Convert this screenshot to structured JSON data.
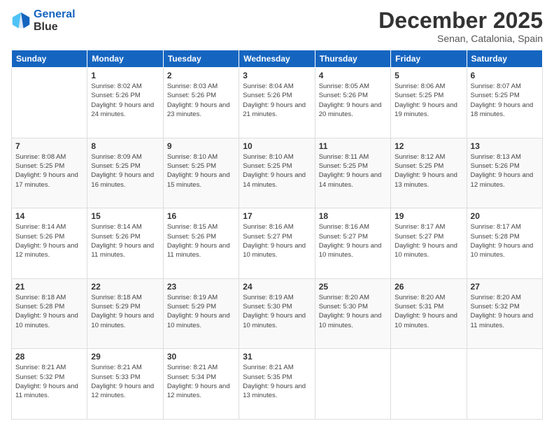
{
  "logo": {
    "line1": "General",
    "line2": "Blue"
  },
  "header": {
    "month": "December 2025",
    "location": "Senan, Catalonia, Spain"
  },
  "weekdays": [
    "Sunday",
    "Monday",
    "Tuesday",
    "Wednesday",
    "Thursday",
    "Friday",
    "Saturday"
  ],
  "weeks": [
    [
      {
        "day": "",
        "info": ""
      },
      {
        "day": "1",
        "info": "Sunrise: 8:02 AM\nSunset: 5:26 PM\nDaylight: 9 hours\nand 24 minutes."
      },
      {
        "day": "2",
        "info": "Sunrise: 8:03 AM\nSunset: 5:26 PM\nDaylight: 9 hours\nand 23 minutes."
      },
      {
        "day": "3",
        "info": "Sunrise: 8:04 AM\nSunset: 5:26 PM\nDaylight: 9 hours\nand 21 minutes."
      },
      {
        "day": "4",
        "info": "Sunrise: 8:05 AM\nSunset: 5:26 PM\nDaylight: 9 hours\nand 20 minutes."
      },
      {
        "day": "5",
        "info": "Sunrise: 8:06 AM\nSunset: 5:25 PM\nDaylight: 9 hours\nand 19 minutes."
      },
      {
        "day": "6",
        "info": "Sunrise: 8:07 AM\nSunset: 5:25 PM\nDaylight: 9 hours\nand 18 minutes."
      }
    ],
    [
      {
        "day": "7",
        "info": "Sunrise: 8:08 AM\nSunset: 5:25 PM\nDaylight: 9 hours\nand 17 minutes."
      },
      {
        "day": "8",
        "info": "Sunrise: 8:09 AM\nSunset: 5:25 PM\nDaylight: 9 hours\nand 16 minutes."
      },
      {
        "day": "9",
        "info": "Sunrise: 8:10 AM\nSunset: 5:25 PM\nDaylight: 9 hours\nand 15 minutes."
      },
      {
        "day": "10",
        "info": "Sunrise: 8:10 AM\nSunset: 5:25 PM\nDaylight: 9 hours\nand 14 minutes."
      },
      {
        "day": "11",
        "info": "Sunrise: 8:11 AM\nSunset: 5:25 PM\nDaylight: 9 hours\nand 14 minutes."
      },
      {
        "day": "12",
        "info": "Sunrise: 8:12 AM\nSunset: 5:25 PM\nDaylight: 9 hours\nand 13 minutes."
      },
      {
        "day": "13",
        "info": "Sunrise: 8:13 AM\nSunset: 5:26 PM\nDaylight: 9 hours\nand 12 minutes."
      }
    ],
    [
      {
        "day": "14",
        "info": "Sunrise: 8:14 AM\nSunset: 5:26 PM\nDaylight: 9 hours\nand 12 minutes."
      },
      {
        "day": "15",
        "info": "Sunrise: 8:14 AM\nSunset: 5:26 PM\nDaylight: 9 hours\nand 11 minutes."
      },
      {
        "day": "16",
        "info": "Sunrise: 8:15 AM\nSunset: 5:26 PM\nDaylight: 9 hours\nand 11 minutes."
      },
      {
        "day": "17",
        "info": "Sunrise: 8:16 AM\nSunset: 5:27 PM\nDaylight: 9 hours\nand 10 minutes."
      },
      {
        "day": "18",
        "info": "Sunrise: 8:16 AM\nSunset: 5:27 PM\nDaylight: 9 hours\nand 10 minutes."
      },
      {
        "day": "19",
        "info": "Sunrise: 8:17 AM\nSunset: 5:27 PM\nDaylight: 9 hours\nand 10 minutes."
      },
      {
        "day": "20",
        "info": "Sunrise: 8:17 AM\nSunset: 5:28 PM\nDaylight: 9 hours\nand 10 minutes."
      }
    ],
    [
      {
        "day": "21",
        "info": "Sunrise: 8:18 AM\nSunset: 5:28 PM\nDaylight: 9 hours\nand 10 minutes."
      },
      {
        "day": "22",
        "info": "Sunrise: 8:18 AM\nSunset: 5:29 PM\nDaylight: 9 hours\nand 10 minutes."
      },
      {
        "day": "23",
        "info": "Sunrise: 8:19 AM\nSunset: 5:29 PM\nDaylight: 9 hours\nand 10 minutes."
      },
      {
        "day": "24",
        "info": "Sunrise: 8:19 AM\nSunset: 5:30 PM\nDaylight: 9 hours\nand 10 minutes."
      },
      {
        "day": "25",
        "info": "Sunrise: 8:20 AM\nSunset: 5:30 PM\nDaylight: 9 hours\nand 10 minutes."
      },
      {
        "day": "26",
        "info": "Sunrise: 8:20 AM\nSunset: 5:31 PM\nDaylight: 9 hours\nand 10 minutes."
      },
      {
        "day": "27",
        "info": "Sunrise: 8:20 AM\nSunset: 5:32 PM\nDaylight: 9 hours\nand 11 minutes."
      }
    ],
    [
      {
        "day": "28",
        "info": "Sunrise: 8:21 AM\nSunset: 5:32 PM\nDaylight: 9 hours\nand 11 minutes."
      },
      {
        "day": "29",
        "info": "Sunrise: 8:21 AM\nSunset: 5:33 PM\nDaylight: 9 hours\nand 12 minutes."
      },
      {
        "day": "30",
        "info": "Sunrise: 8:21 AM\nSunset: 5:34 PM\nDaylight: 9 hours\nand 12 minutes."
      },
      {
        "day": "31",
        "info": "Sunrise: 8:21 AM\nSunset: 5:35 PM\nDaylight: 9 hours\nand 13 minutes."
      },
      {
        "day": "",
        "info": ""
      },
      {
        "day": "",
        "info": ""
      },
      {
        "day": "",
        "info": ""
      }
    ]
  ]
}
